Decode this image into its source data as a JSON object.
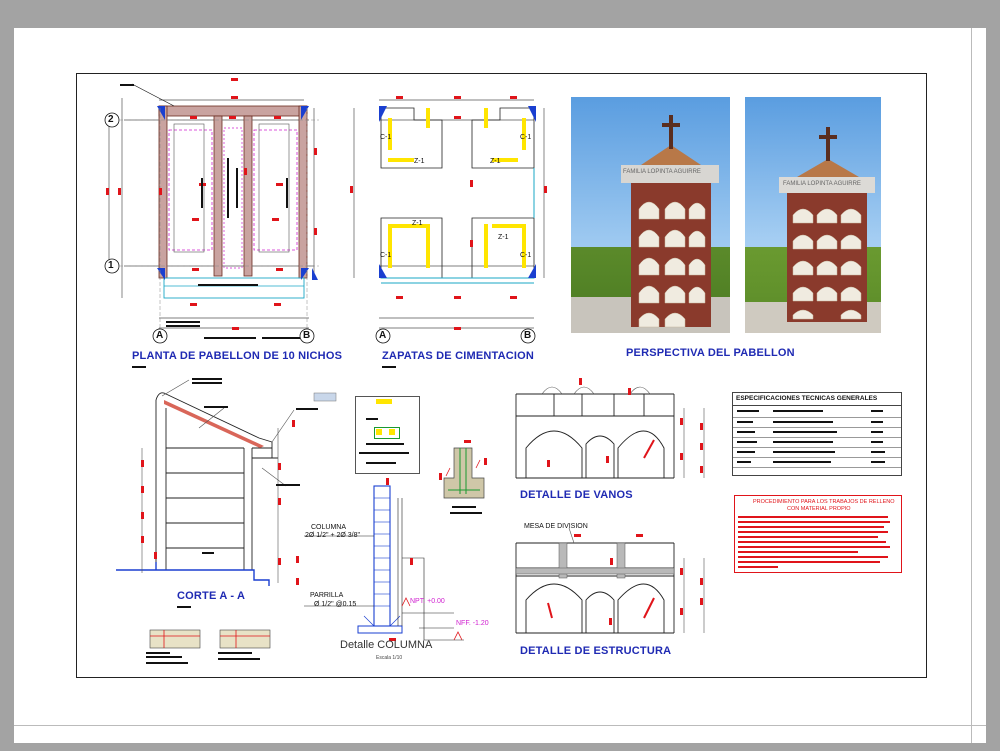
{
  "titles": {
    "plan": "PLANTA DE PABELLON DE 10 NICHOS",
    "footings": "ZAPATAS DE CIMENTACION",
    "perspective": "PERSPECTIVA DEL PABELLON",
    "section": "CORTE A - A",
    "openings": "DETALLE DE VANOS",
    "structure": "DETALLE DE ESTRUCTURA",
    "column_detail": "Detalle COLUMNA",
    "column_scale": "Escala 1/10",
    "specs": "ESPECIFICACIONES TECNICAS GENERALES",
    "procedure_1": "PROCEDIMIENTO PARA LOS TRABAJOS DE RELLENO",
    "procedure_2": "CON MATERIAL PROPIO"
  },
  "grid": {
    "axis_1": "1",
    "axis_2": "2",
    "axis_a": "A",
    "axis_b": "B"
  },
  "footing_labels": {
    "c1": "C-1",
    "z1": "Z-1"
  },
  "notes": {
    "mesa": "MESA DE DIVISION",
    "columna": "COLUMNA",
    "columna_bars": "2Ø 1/2\" + 2Ø 3/8\"",
    "parrilla": "PARRILLA",
    "parrilla_bars": "Ø 1/2\" @0.15",
    "npt": "NPT. +0.00",
    "nff": "NFF. -1.20"
  },
  "render": {
    "sign_text": "FAMILIA LOPINTA AGUIRRE"
  },
  "colors": {
    "title_blue": "#1f2ab3",
    "dim_red": "#e0141a",
    "hatch_yellow": "#ffe500",
    "brick": "#8a3a2c",
    "grid_blue": "#1a3fd0",
    "magenta": "#d020d0"
  }
}
